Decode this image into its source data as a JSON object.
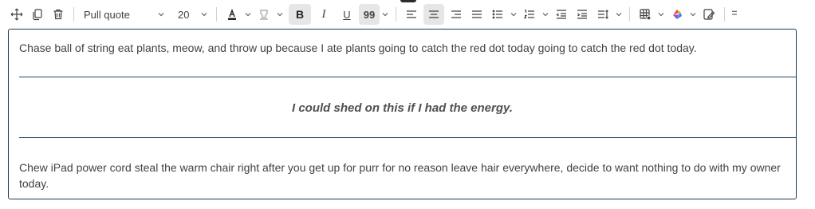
{
  "toolbar": {
    "style_dropdown": "Pull quote",
    "font_size": "20",
    "bold_label": "B",
    "italic_label": "I",
    "underline_label": "U",
    "quote_label": "99",
    "icons": [
      "move-icon",
      "copy-icon",
      "delete-icon",
      "font-color-icon",
      "highlight-icon",
      "align-left-icon",
      "align-center-icon",
      "align-right-icon",
      "justify-icon",
      "bullet-list-icon",
      "numbered-list-icon",
      "decrease-indent-icon",
      "increase-indent-icon",
      "line-spacing-icon",
      "table-icon",
      "copilot-icon",
      "rewrite-icon"
    ]
  },
  "editor": {
    "paragraph1": "Chase ball of string eat plants, meow, and throw up because I ate plants going to catch the red dot today going to catch the red dot today.",
    "pull_quote": "I could shed on this if I had the energy.",
    "paragraph2": "Chew iPad power cord steal the warm chair right after you get up for purr for no reason leave hair everywhere, decide to want nothing to do with my owner today."
  },
  "colors": {
    "editor_border": "#1f3a55",
    "active_button_bg": "#e6e6e6",
    "text": "#424242"
  }
}
